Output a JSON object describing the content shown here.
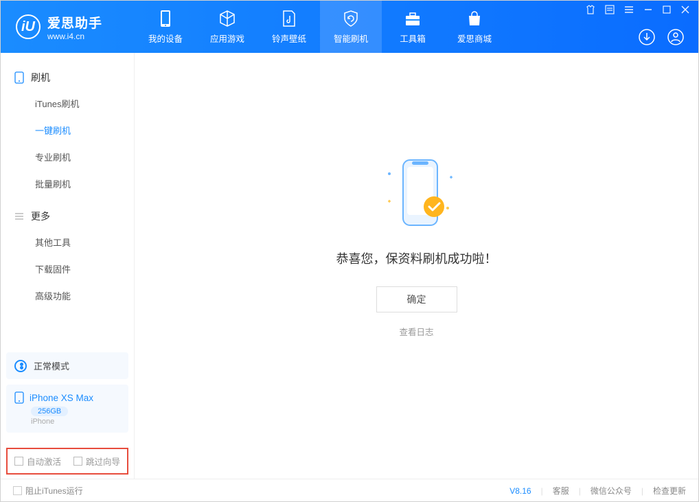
{
  "app": {
    "name": "爱思助手",
    "url": "www.i4.cn"
  },
  "nav": {
    "my_device": "我的设备",
    "apps_games": "应用游戏",
    "ringtones": "铃声壁纸",
    "smart_flash": "智能刷机",
    "toolbox": "工具箱",
    "store": "爱思商城"
  },
  "sidebar": {
    "flash_title": "刷机",
    "items": {
      "itunes": "iTunes刷机",
      "oneclick": "一键刷机",
      "pro": "专业刷机",
      "batch": "批量刷机"
    },
    "more_title": "更多",
    "more": {
      "other_tools": "其他工具",
      "download_fw": "下载固件",
      "advanced": "高级功能"
    },
    "mode_label": "正常模式",
    "device_name": "iPhone XS Max",
    "storage": "256GB",
    "device_type": "iPhone",
    "auto_activate": "自动激活",
    "skip_wizard": "跳过向导"
  },
  "main": {
    "success_msg": "恭喜您，保资料刷机成功啦！",
    "ok": "确定",
    "view_log": "查看日志"
  },
  "footer": {
    "block_itunes": "阻止iTunes运行",
    "version": "V8.16",
    "support": "客服",
    "wechat": "微信公众号",
    "update": "检查更新"
  }
}
